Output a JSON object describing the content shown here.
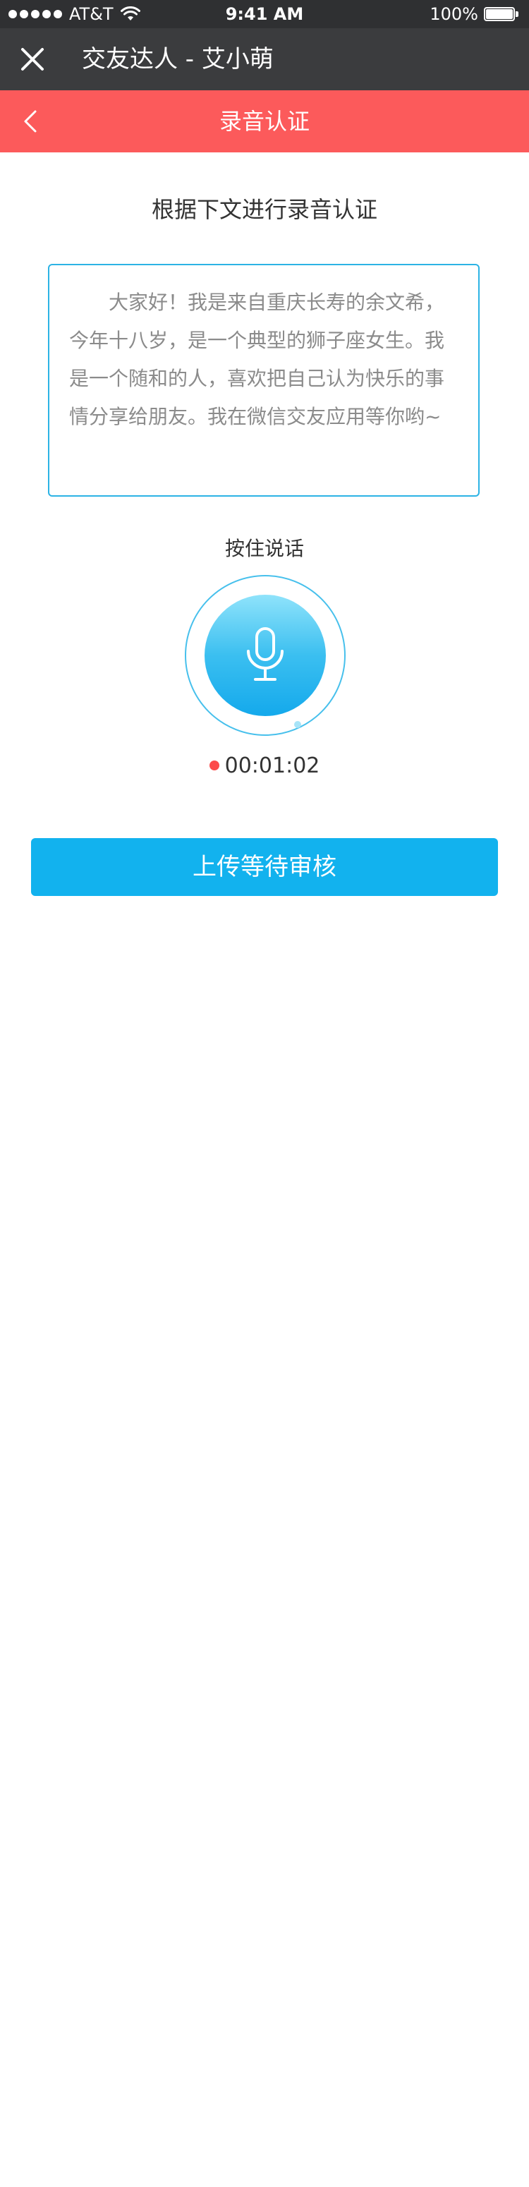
{
  "status_bar": {
    "carrier": "AT&T",
    "time": "9:41 AM",
    "battery": "100%"
  },
  "app_bar": {
    "title": "交友达人 - 艾小萌"
  },
  "nav_bar": {
    "title": "录音认证"
  },
  "main": {
    "instruction": "根据下文进行录音认证",
    "script_text": "大家好！我是来自重庆长寿的余文希，今年十八岁，是一个典型的狮子座女生。我是一个随和的人，喜欢把自己认为快乐的事情分享给朋友。我在微信交友应用等你哟~",
    "hold_label": "按住说话",
    "timer": "00:01:02",
    "upload_button": "上传等待审核"
  },
  "colors": {
    "status_bar_bg": "#2f3032",
    "app_bar_bg": "#3b3c3e",
    "nav_bar_bg": "#fc5a5b",
    "accent_blue": "#12b2ee",
    "script_border": "#2cb3e5",
    "recording_dot": "#fc4b4b"
  },
  "icons": {
    "close": "close-icon",
    "back": "chevron-left-icon",
    "microphone": "microphone-icon",
    "wifi": "wifi-icon",
    "battery": "battery-icon"
  }
}
